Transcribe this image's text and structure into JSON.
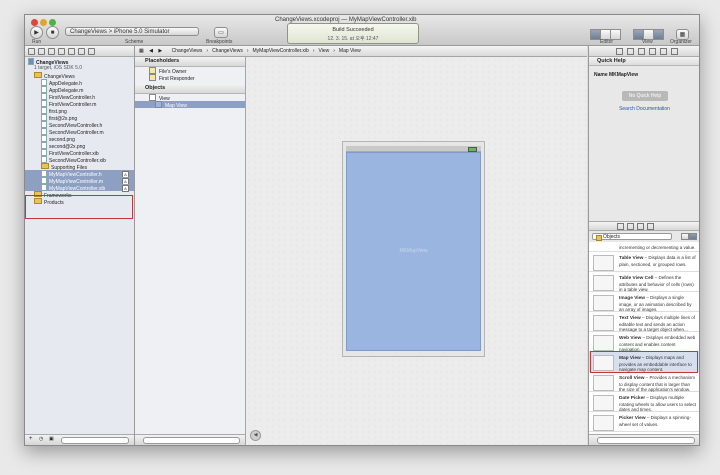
{
  "window": {
    "file_title": "ChangeViews.xcodeproj — MyMapViewController.xib",
    "run_label": "Run",
    "stop_label": "Stop",
    "scheme_value": "ChangeViews > iPhone 5.0 Simulator",
    "scheme_label": "Scheme",
    "breakpoints_label": "Breakpoints",
    "activity_title": "Build Succeeded",
    "activity_sub": "12. 3. 15. at 오후 12:47",
    "editor_label": "Editor",
    "view_label": "View",
    "organizer_label": "Organizer"
  },
  "navigator": {
    "project_name": "ChangeViews",
    "project_sub": "1 target, iOS SDK 5.0",
    "items": [
      {
        "label": "ChangeViews",
        "kind": "folder",
        "indent": 1
      },
      {
        "label": "AppDelegate.h",
        "kind": "file",
        "indent": 2
      },
      {
        "label": "AppDelegate.m",
        "kind": "file",
        "indent": 2
      },
      {
        "label": "FirstViewController.h",
        "kind": "file",
        "indent": 2
      },
      {
        "label": "FirstViewController.m",
        "kind": "file",
        "indent": 2
      },
      {
        "label": "first.png",
        "kind": "file",
        "indent": 2
      },
      {
        "label": "first@2x.png",
        "kind": "file",
        "indent": 2
      },
      {
        "label": "SecondViewController.h",
        "kind": "file",
        "indent": 2
      },
      {
        "label": "SecondViewController.m",
        "kind": "file",
        "indent": 2
      },
      {
        "label": "second.png",
        "kind": "file",
        "indent": 2
      },
      {
        "label": "second@2x.png",
        "kind": "file",
        "indent": 2
      },
      {
        "label": "FirstViewController.xib",
        "kind": "file",
        "indent": 2
      },
      {
        "label": "SecondViewController.xib",
        "kind": "file",
        "indent": 2
      },
      {
        "label": "Supporting Files",
        "kind": "folder",
        "indent": 2
      },
      {
        "label": "MyMapViewController.h",
        "kind": "file",
        "indent": 2,
        "badge": "A",
        "selected": true
      },
      {
        "label": "MyMapViewController.m",
        "kind": "file",
        "indent": 2,
        "badge": "A",
        "selected": true
      },
      {
        "label": "MyMapViewController.xib",
        "kind": "file",
        "indent": 2,
        "badge": "A",
        "selected": true
      },
      {
        "label": "Frameworks",
        "kind": "folder",
        "indent": 1
      },
      {
        "label": "Products",
        "kind": "folder",
        "indent": 1
      }
    ]
  },
  "jumpbar": {
    "crumbs": [
      "ChangeViews",
      "ChangeViews",
      "MyMapViewController.xib",
      "View",
      "Map View"
    ]
  },
  "outline": {
    "placeholders_title": "Placeholders",
    "placeholders": [
      "File's Owner",
      "First Responder"
    ],
    "objects_title": "Objects",
    "objects": [
      "View",
      "Map View"
    ]
  },
  "canvas": {
    "map_watermark": "MKMapView"
  },
  "utilities": {
    "quick_help_title": "Quick Help",
    "name_line": "Name MKMapView",
    "no_quick_help": "No Quick Help",
    "search_docs": "Search Documentation",
    "library_selector": "Objects",
    "library_items": [
      {
        "title": "",
        "text": "incrementing or decrementing a value."
      },
      {
        "title": "Table View",
        "text": "– Displays data in a list of plain, sectioned, or grouped rows."
      },
      {
        "title": "Table View Cell",
        "text": "– Defines the attributes and behavior of cells (rows) in a table view."
      },
      {
        "title": "Image View",
        "text": "– Displays a single image, or an animation described by an array of images."
      },
      {
        "title": "Text View",
        "text": "– Displays multiple lines of editable text and sends an action message to a target object when..."
      },
      {
        "title": "Web View",
        "text": "– Displays embedded web content and enables content navigation."
      },
      {
        "title": "Map View",
        "text": "– Displays maps and provides an embeddable interface to navigate map content.",
        "highlighted": true
      },
      {
        "title": "Scroll View",
        "text": "– Provides a mechanism to display content that is larger than the size of the application's window."
      },
      {
        "title": "Date Picker",
        "text": "– Displays multiple rotating wheels to allow users to select dates and times."
      },
      {
        "title": "Picker View",
        "text": "– Displays a spinning-wheel set of values."
      }
    ]
  }
}
